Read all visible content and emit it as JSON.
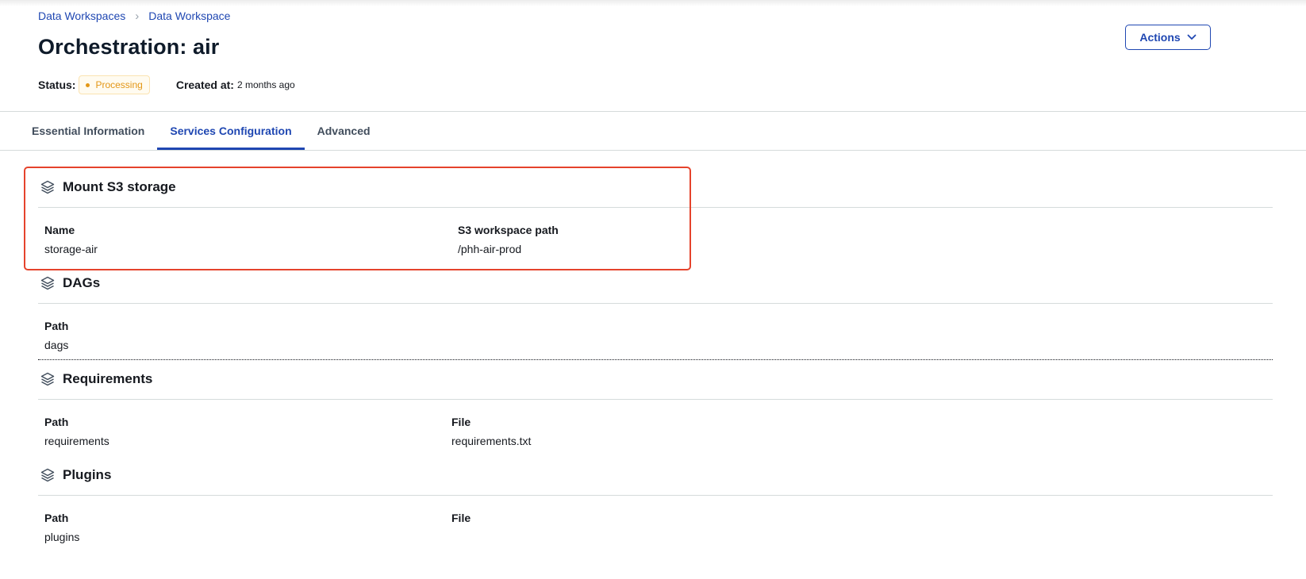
{
  "breadcrumb": {
    "items": [
      "Data Workspaces",
      "Data Workspace"
    ],
    "separator": "›"
  },
  "page_title": "Orchestration: air",
  "status": {
    "label": "Status:",
    "value": "Processing",
    "color": "#e39716"
  },
  "created": {
    "label": "Created at:",
    "value": "2 months ago"
  },
  "actions": {
    "label": "Actions",
    "icon": "chevron-down-icon"
  },
  "tabs": [
    {
      "label": "Essential Information",
      "active": false
    },
    {
      "label": "Services Configuration",
      "active": true
    },
    {
      "label": "Advanced",
      "active": false
    }
  ],
  "sections": {
    "mount_s3": {
      "title": "Mount S3 storage",
      "icon": "layers-icon",
      "fields": [
        {
          "label": "Name",
          "value": "storage-air"
        },
        {
          "label": "S3 workspace path",
          "value": "/phh-air-prod"
        }
      ]
    },
    "dags": {
      "title": "DAGs",
      "icon": "layers-icon",
      "fields": [
        {
          "label": "Path",
          "value": "dags"
        }
      ]
    },
    "requirements": {
      "title": "Requirements",
      "icon": "layers-icon",
      "fields": [
        {
          "label": "Path",
          "value": "requirements"
        },
        {
          "label": "File",
          "value": "requirements.txt"
        }
      ]
    },
    "plugins": {
      "title": "Plugins",
      "icon": "layers-icon",
      "fields": [
        {
          "label": "Path",
          "value": "plugins"
        },
        {
          "label": "File",
          "value": ""
        }
      ]
    }
  },
  "colors": {
    "accent": "#1f47b2",
    "highlight": "#e5432c",
    "divider": "#d5dbdb"
  }
}
